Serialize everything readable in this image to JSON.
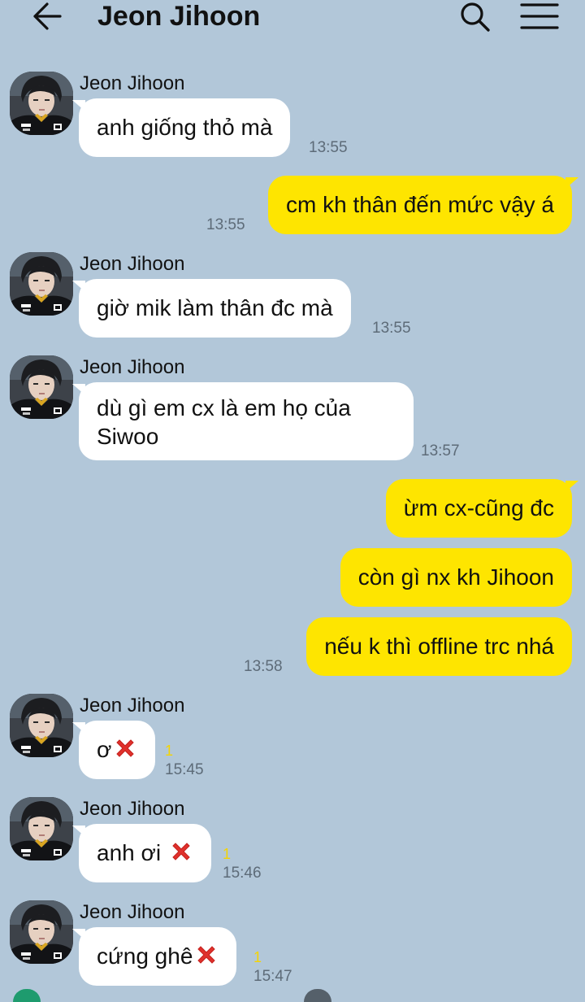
{
  "header": {
    "title": "Jeon Jihoon",
    "back_icon": "arrow-left-icon",
    "search_icon": "search-icon",
    "menu_icon": "hamburger-menu-icon"
  },
  "colors": {
    "background": "#b2c7d9",
    "incoming_bubble": "#ffffff",
    "outgoing_bubble": "#fee500",
    "unread_count": "#f5d400",
    "timestamp": "#5d6b78"
  },
  "messages": [
    {
      "direction": "in",
      "sender": "Jeon Jihoon",
      "text": "anh giống thỏ mà",
      "time": "13:55"
    },
    {
      "direction": "out",
      "text": "cm kh thân đến mức vậy á",
      "time": "13:55"
    },
    {
      "direction": "in",
      "sender": "Jeon Jihoon",
      "text": "giờ mik làm thân đc mà",
      "time": "13:55"
    },
    {
      "direction": "in",
      "sender": "Jeon Jihoon",
      "text_line1": "dù gì em cx là em họ của",
      "text_line2": "Siwoo",
      "time": "13:57"
    },
    {
      "direction": "out",
      "text": "ừm cx-cũng đc"
    },
    {
      "direction": "out",
      "text": "còn gì nx kh Jihoon"
    },
    {
      "direction": "out",
      "text": "nếu k thì offline trc nhá",
      "time": "13:58"
    },
    {
      "direction": "in",
      "sender": "Jeon Jihoon",
      "text": "ơ",
      "icon": "red-x-icon",
      "unread": "1",
      "time": "15:45"
    },
    {
      "direction": "in",
      "sender": "Jeon Jihoon",
      "text": "anh ơi ",
      "icon": "red-x-icon",
      "unread": "1",
      "time": "15:46"
    },
    {
      "direction": "in",
      "sender": "Jeon Jihoon",
      "text": "cứng ghê",
      "icon": "red-x-icon",
      "unread": "1",
      "time": "15:47"
    }
  ]
}
